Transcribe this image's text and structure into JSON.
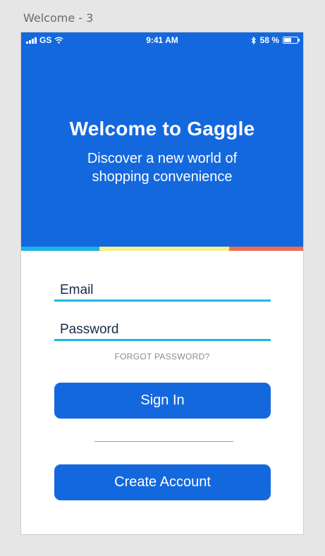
{
  "artboard": {
    "label": "Welcome - 3"
  },
  "status_bar": {
    "carrier": "GS",
    "time": "9:41 AM",
    "battery_percent": "58 %",
    "battery_level": 0.58
  },
  "hero": {
    "title": "Welcome to Gaggle",
    "subtitle": "Discover a new world of shopping convenience"
  },
  "form": {
    "email_placeholder": "Email",
    "password_placeholder": "Password",
    "forgot_password": "FORGOT PASSWORD?",
    "sign_in_label": "Sign In",
    "create_account_label": "Create Account"
  },
  "colors": {
    "primary": "#1468de",
    "accent_blue": "#1cb3e6",
    "accent_yellow": "#f6ef8a",
    "accent_red": "#ef6e54"
  },
  "icons": [
    "signal-icon",
    "wifi-icon",
    "bluetooth-icon",
    "battery-icon"
  ]
}
